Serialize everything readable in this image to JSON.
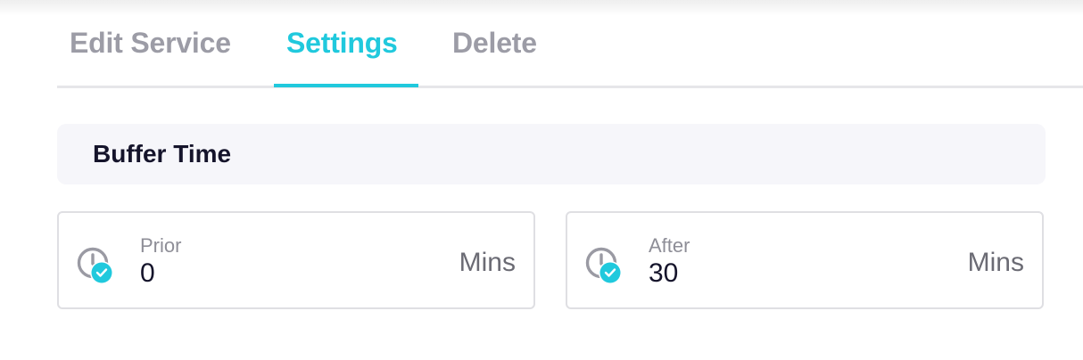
{
  "tabs": [
    {
      "label": "Edit Service",
      "active": false
    },
    {
      "label": "Settings",
      "active": true
    },
    {
      "label": "Delete",
      "active": false
    }
  ],
  "section": {
    "title": "Buffer Time"
  },
  "buffers": [
    {
      "label": "Prior",
      "value": "0",
      "unit": "Mins",
      "icon": "clock-check-icon"
    },
    {
      "label": "After",
      "value": "30",
      "unit": "Mins",
      "icon": "clock-check-icon"
    }
  ],
  "colors": {
    "accent": "#20c9dd",
    "tab_inactive": "#9c9ca6",
    "title": "#15142b",
    "header_bg": "#f6f6fa",
    "border": "#dfdfe3"
  }
}
